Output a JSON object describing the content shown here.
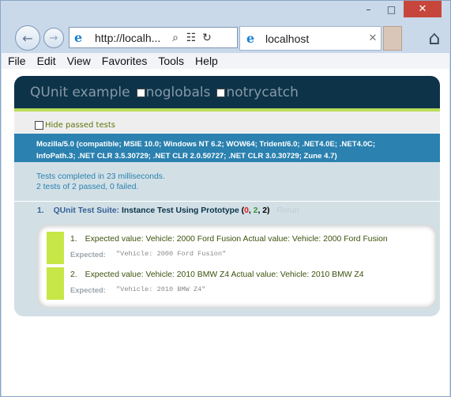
{
  "window": {
    "minimize_glyph": "–",
    "maximize_glyph": "□",
    "close_glyph": "✕"
  },
  "nav": {
    "back_glyph": "←",
    "forward_glyph": "→",
    "url": "http://localh...",
    "search_glyph": "⌕",
    "compat_glyph": "☷",
    "refresh_glyph": "↻",
    "ie_glyph": "e",
    "tab_title": "localhost",
    "tab_close_glyph": "✕",
    "home_glyph": "⌂"
  },
  "menu": [
    "File",
    "Edit",
    "View",
    "Favorites",
    "Tools",
    "Help"
  ],
  "qunit": {
    "title": "QUnit example",
    "option_noglobals": "noglobals",
    "option_notrycatch": "notrycatch",
    "hide_passed_label": "Hide passed tests",
    "user_agent_line1": "Mozilla/5.0 (compatible; MSIE 10.0; Windows NT 6.2; WOW64; Trident/6.0; .NET4.0E; .NET4.0C;",
    "user_agent_line2": "InfoPath.3; .NET CLR 3.5.30729; .NET CLR 2.0.50727; .NET CLR 3.0.30729; Zune 4.7)",
    "result_line1": "Tests completed in 23 milliseconds.",
    "result_line2": "2 tests of 2 passed, 0 failed.",
    "test": {
      "number": "1.",
      "module": "QUnit Test Suite:",
      "name": "Instance Test Using Prototype",
      "count_open": "(",
      "failed": "0",
      "sep1": ", ",
      "passed": "2",
      "sep2": ", ",
      "total": "2",
      "count_close": ")",
      "rerun": "Rerun"
    },
    "assertions": [
      {
        "number": "1.",
        "message": "Expected value: Vehicle: 2000 Ford Fusion Actual value: Vehicle: 2000 Ford Fusion",
        "expected_label": "Expected:",
        "expected_value": "\"Vehicle: 2000 Ford Fusion\""
      },
      {
        "number": "2.",
        "message": "Expected value: Vehicle: 2010 BMW Z4 Actual value: Vehicle: 2010 BMW Z4",
        "expected_label": "Expected:",
        "expected_value": "\"Vehicle: 2010 BMW Z4\""
      }
    ]
  },
  "colors": {
    "header_bg": "#0d3349",
    "accent_green": "#b8dd5a",
    "ua_bg": "#2b81af",
    "pass_bar": "#c6e746",
    "close_button": "#c7463c"
  }
}
